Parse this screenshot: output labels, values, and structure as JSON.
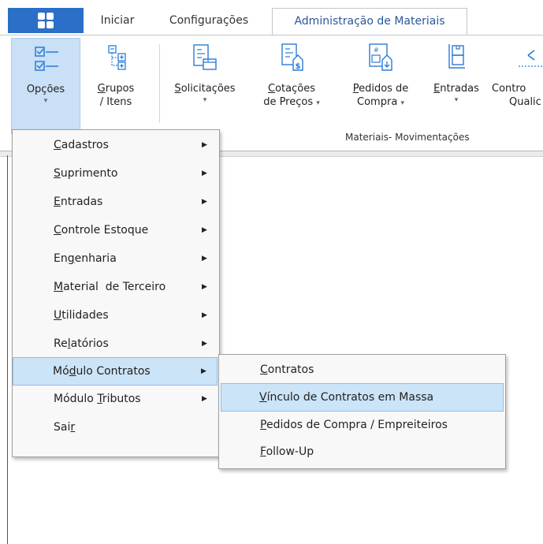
{
  "tabs": [
    {
      "label": "Iniciar",
      "active": false
    },
    {
      "label": "Configurações",
      "active": false
    },
    {
      "label": "Administração de Materiais",
      "active": true
    }
  ],
  "ribbon": {
    "buttons": [
      {
        "line1": "Opções",
        "line2": "",
        "dropdown": true,
        "pressed": true
      },
      {
        "line1": "Grupos",
        "line2": "/ Itens",
        "dropdown": false,
        "pressed": false
      },
      {
        "line1": "Solicitações",
        "line2": "",
        "dropdown": true,
        "pressed": false
      },
      {
        "line1": "Cotações",
        "line2": "de Preços",
        "dropdown": true,
        "pressed": false
      },
      {
        "line1": "Pedidos de",
        "line2": "Compra",
        "dropdown": true,
        "pressed": false
      },
      {
        "line1": "Entradas",
        "line2": "",
        "dropdown": true,
        "pressed": false
      },
      {
        "line1": "Contro",
        "line2": "Qualic",
        "dropdown": false,
        "pressed": false
      }
    ],
    "group_label": "Materiais- Movimentações"
  },
  "main_menu": {
    "items": [
      {
        "pre": "",
        "u": "C",
        "post": "adastros",
        "submenu": true,
        "highlighted": false
      },
      {
        "pre": "",
        "u": "S",
        "post": "uprimento",
        "submenu": true,
        "highlighted": false
      },
      {
        "pre": "",
        "u": "E",
        "post": "ntradas",
        "submenu": true,
        "highlighted": false
      },
      {
        "pre": "",
        "u": "C",
        "post": "ontrole Estoque",
        "submenu": true,
        "highlighted": false
      },
      {
        "pre": "En",
        "u": "g",
        "post": "enharia",
        "submenu": true,
        "highlighted": false
      },
      {
        "pre": "",
        "u": "M",
        "post": "aterial  de Terceiro",
        "submenu": true,
        "highlighted": false
      },
      {
        "pre": "",
        "u": "U",
        "post": "tilidades",
        "submenu": true,
        "highlighted": false
      },
      {
        "pre": "Re",
        "u": "l",
        "post": "atórios",
        "submenu": true,
        "highlighted": false
      },
      {
        "pre": "Mó",
        "u": "d",
        "post": "ulo Contratos",
        "submenu": true,
        "highlighted": true
      },
      {
        "pre": "Módulo ",
        "u": "T",
        "post": "ributos",
        "submenu": true,
        "highlighted": false
      },
      {
        "pre": "Sai",
        "u": "r",
        "post": "",
        "submenu": false,
        "highlighted": false
      }
    ]
  },
  "sub_menu": {
    "items": [
      {
        "pre": "",
        "u": "C",
        "post": "ontratos",
        "highlighted": false
      },
      {
        "pre": "",
        "u": "V",
        "post": "ínculo de Contratos em Massa",
        "highlighted": true
      },
      {
        "pre": "",
        "u": "P",
        "post": "edidos de Compra / Empreiteiros",
        "highlighted": false
      },
      {
        "pre": "",
        "u": "F",
        "post": "ollow-Up",
        "highlighted": false
      }
    ]
  },
  "colors": {
    "accent": "#2b6fc8",
    "highlight": "#cce4f7",
    "highlight_border": "#8ebce8",
    "icon_blue": "#2b7bd6"
  },
  "icons": {
    "app": "apps-grid-icon",
    "submenu": "chevron-right-icon",
    "dropdown": "chevron-down-icon"
  }
}
